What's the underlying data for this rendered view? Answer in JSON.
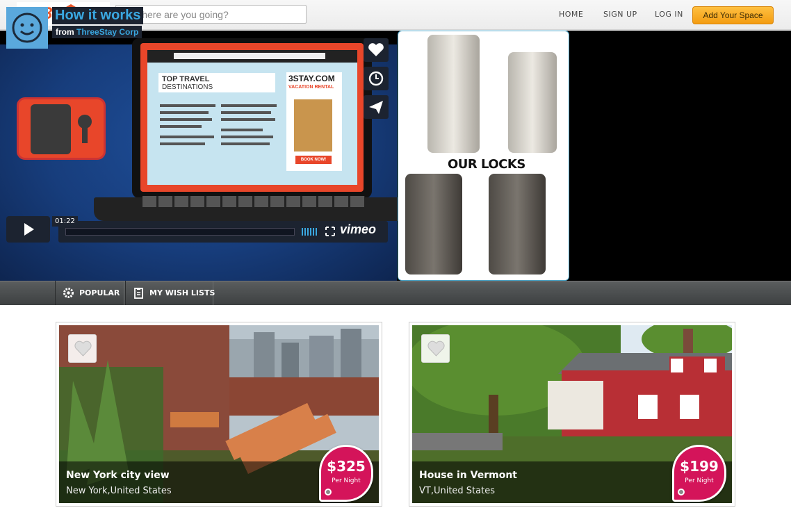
{
  "header": {
    "logo_text": "3stay",
    "search": {
      "placeholder": "Where are you going?",
      "value": ""
    },
    "nav": {
      "home": "HOME",
      "signup": "SIGN UP",
      "login": "LOG IN",
      "add_space": "Add Your Space"
    }
  },
  "video": {
    "title": "How it works",
    "from_label": "from",
    "owner": "ThreeStay Corp",
    "time": "01:22",
    "brand": "vimeo",
    "screen": {
      "heading1": "TOP TRAVEL",
      "heading2": "DESTINATIONS",
      "ad_title": "3STAY.COM",
      "ad_sub": "VACATION RENTAL",
      "ad_button": "BOOK NOW!"
    }
  },
  "locks": {
    "label": "OUR LOCKS"
  },
  "filters": [
    {
      "label": "POPULAR",
      "icon": "gear-icon"
    },
    {
      "label": "MY WISH LISTS",
      "icon": "clipboard-icon"
    }
  ],
  "listings": [
    {
      "name": "New York city view",
      "location": "New York,United States",
      "price": "$325",
      "per": "Per Night"
    },
    {
      "name": "House in Vermont",
      "location": "VT,United States",
      "price": "$199",
      "per": "Per Night"
    }
  ],
  "colors": {
    "accent": "#f39c12",
    "price": "#d4145a",
    "link": "#3aa7e0"
  }
}
